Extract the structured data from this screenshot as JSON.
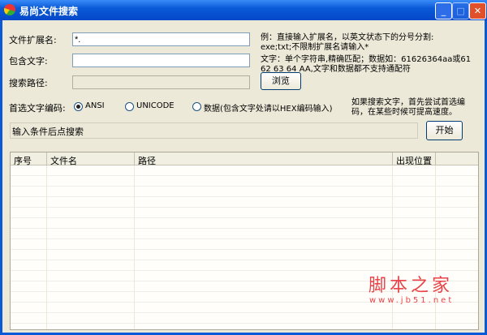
{
  "window": {
    "title": "易尚文件搜索",
    "minimize": "_",
    "maximize": "□",
    "close": "✕"
  },
  "form": {
    "ext_label": "文件扩展名:",
    "ext_value": "*.",
    "text_label": "包含文字:",
    "text_value": "",
    "path_label": "搜索路径:",
    "path_value": "",
    "browse": "浏览",
    "hint1_line1": "例：直接输入扩展名，以英文状态下的分号分割:",
    "hint1_line2": "exe;txt;不限制扩展名请输入*",
    "hint2_line1": "文字：单个字符串,精确匹配；数据如：61626364aa或61",
    "hint2_line2": "62 63 64 AA,文字和数据都不支持通配符",
    "encoding_label": "首选文字编码:",
    "encodings": [
      {
        "label": "ANSI",
        "selected": true
      },
      {
        "label": "UNICODE",
        "selected": false
      },
      {
        "label": "数据(包含文字处请以HEX编码输入)",
        "selected": false
      }
    ],
    "hint3_line1": "如果搜索文字，首先尝试首选编",
    "hint3_line2": "码，在某些时候可提高速度。",
    "status": "输入条件后点搜索",
    "start": "开始"
  },
  "table": {
    "columns": [
      "序号",
      "文件名",
      "路径",
      "出现位置",
      ""
    ],
    "rows": []
  },
  "watermark": {
    "text": "脚本之家",
    "url": "www.jb51.net"
  }
}
